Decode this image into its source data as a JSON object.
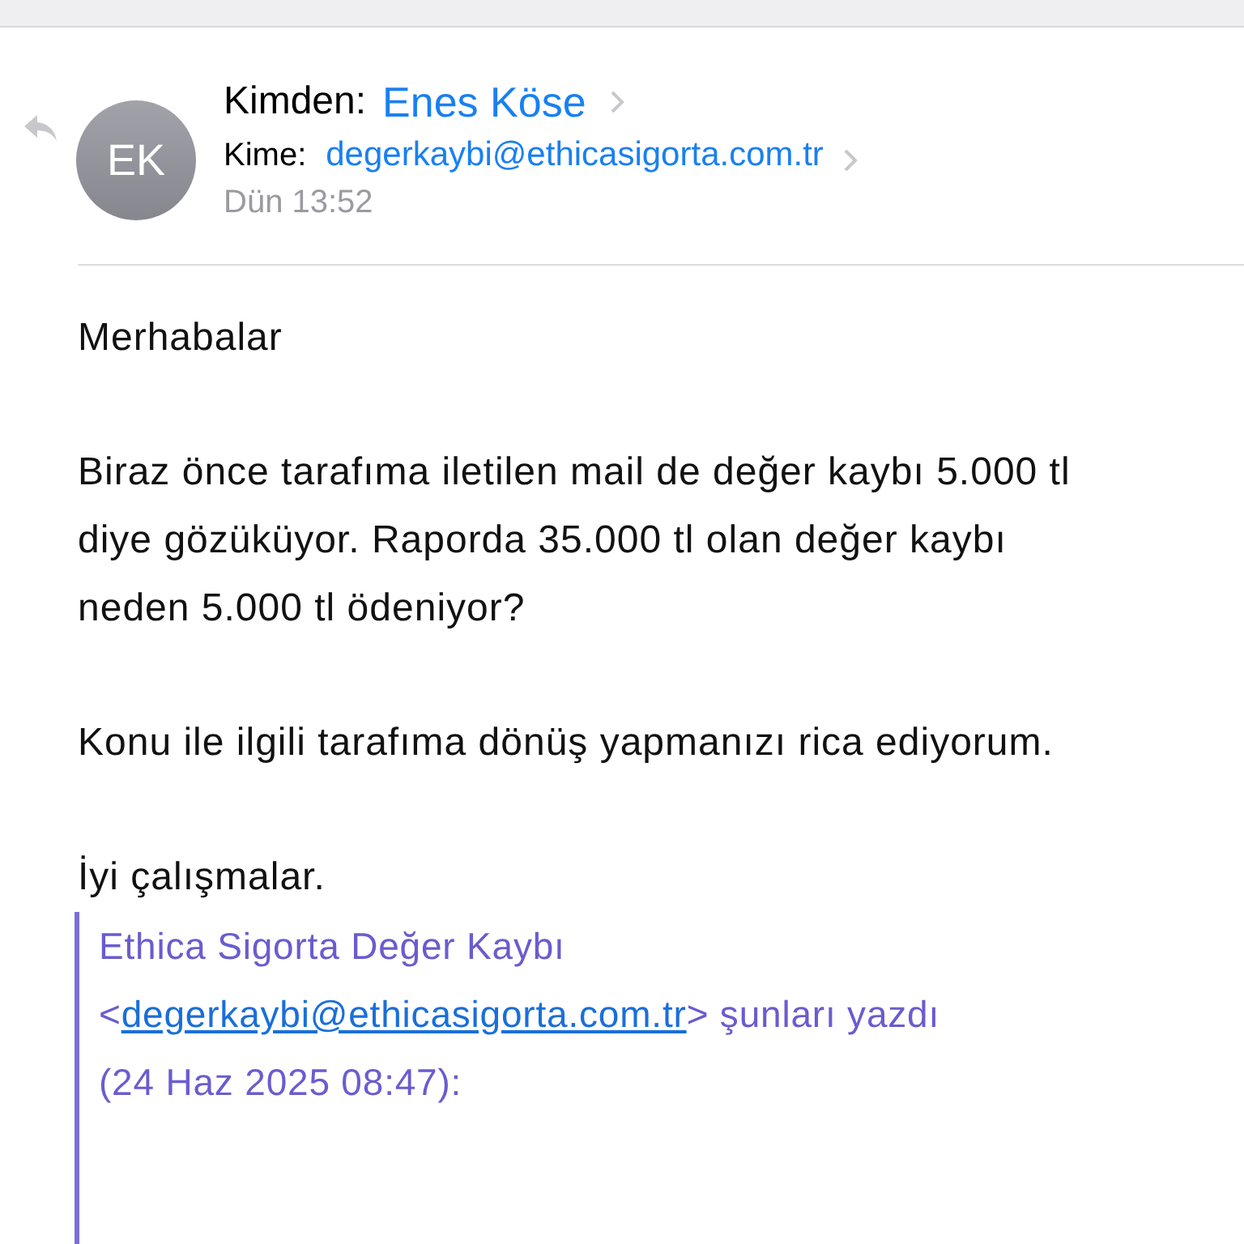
{
  "header": {
    "avatar": "EK",
    "from_label": "Kimden:",
    "from_name": "Enes Köse",
    "to_label": "Kime:",
    "to_address": "degerkaybi@ethicasigorta.com.tr",
    "date": "Dün 13:52"
  },
  "body": [
    "Merhabalar",
    "Biraz önce tarafıma iletilen mail de değer kaybı 5.000 tl diye gözüküyor. Raporda 35.000 tl olan değer kaybı neden 5.000 tl ödeniyor?",
    "Konu ile ilgili tarafıma dönüş yapmanızı rica ediyorum.",
    "İyi çalışmalar."
  ],
  "quote": {
    "sender": "Ethica Sigorta Değer Kaybı",
    "open": "<",
    "email": "degerkaybi@ethicasigorta.com.tr",
    "close": ">",
    "wrote": "şunları yazdı",
    "date": "(24 Haz 2025 08:47):"
  }
}
